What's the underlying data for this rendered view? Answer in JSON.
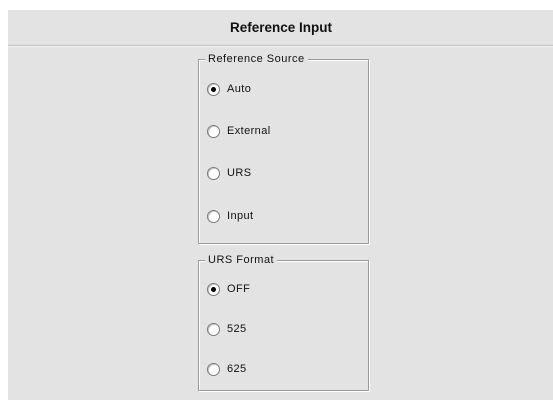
{
  "header": {
    "title": "Reference Input"
  },
  "reference_source": {
    "title": "Reference Source",
    "selected": "Auto",
    "options": [
      "Auto",
      "External",
      "URS",
      "Input"
    ]
  },
  "urs_format": {
    "title": "URS Format",
    "selected": "OFF",
    "options": [
      "OFF",
      "525",
      "625"
    ]
  },
  "colors": {
    "panel_background": "#e3e3e3",
    "group_border": "#9a9a9a",
    "text": "#111111"
  }
}
